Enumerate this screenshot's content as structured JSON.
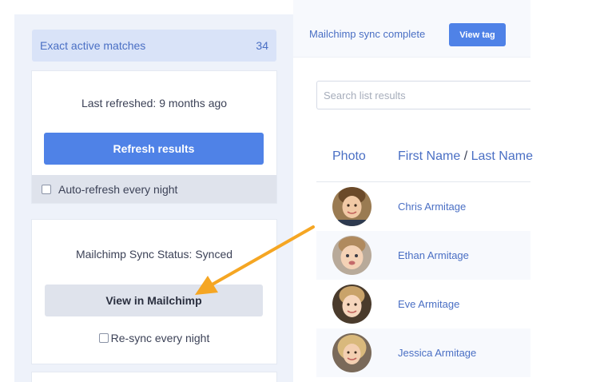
{
  "sidebar": {
    "matches_label": "Exact active matches",
    "matches_count": "34",
    "last_refreshed": "Last refreshed: 9 months ago",
    "refresh_button": "Refresh results",
    "auto_refresh_label": "Auto-refresh every night",
    "sync_status": "Mailchimp Sync Status: Synced",
    "view_mailchimp_button": "View in Mailchimp",
    "resync_label": "Re-sync every night"
  },
  "topbar": {
    "sync_message": "Mailchimp sync complete",
    "view_tag_button": "View tag"
  },
  "search": {
    "placeholder": "Search list results"
  },
  "table": {
    "col_photo": "Photo",
    "col_first_name": "First Name",
    "col_separator": "/",
    "col_last_name": "Last Name",
    "rows": [
      {
        "name": "Chris Armitage"
      },
      {
        "name": "Ethan Armitage"
      },
      {
        "name": "Eve Armitage"
      },
      {
        "name": "Jessica Armitage"
      }
    ]
  },
  "colors": {
    "accent": "#4f82e7",
    "link": "#4a6fc4",
    "annotation_arrow": "#f5a623"
  }
}
